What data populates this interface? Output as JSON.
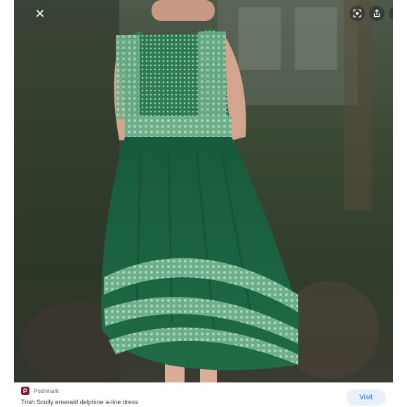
{
  "overlay": {
    "close_icon": "close-icon",
    "lens_icon": "google-lens-icon",
    "share_icon": "share-icon",
    "bookmark_icon": "bookmark-icon"
  },
  "result": {
    "source_name": "Poshmark",
    "title": "Trish Scully emerald delphine a-line dress",
    "visit_label": "Visit"
  },
  "colors": {
    "dress_green": "#1f6b45",
    "lace_green": "#8fc7a6",
    "visit_bg": "#e8f0fe",
    "visit_text": "#1a73e8",
    "poshmark_brand": "#7d1d2d"
  }
}
